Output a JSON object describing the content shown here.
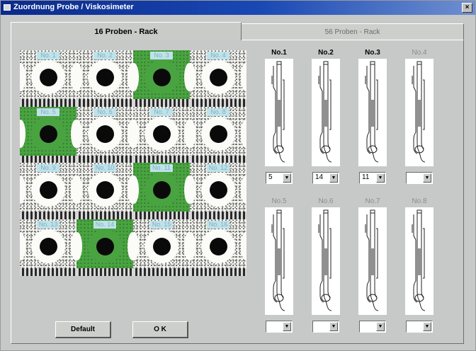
{
  "window": {
    "title": "Zuordnung Probe / Viskosimeter",
    "close_label": "×"
  },
  "tabs": [
    {
      "label": "16 Proben - Rack",
      "active": true
    },
    {
      "label": "56 Proben - Rack",
      "active": false
    }
  ],
  "rack": {
    "cells": [
      {
        "label": "No. 1",
        "selected": false
      },
      {
        "label": "No. 2",
        "selected": false
      },
      {
        "label": "No. 3",
        "selected": true
      },
      {
        "label": "No. 4",
        "selected": false
      },
      {
        "label": "No. 5",
        "selected": true
      },
      {
        "label": "No. 6",
        "selected": false
      },
      {
        "label": "No. 7",
        "selected": false
      },
      {
        "label": "No. 8",
        "selected": false
      },
      {
        "label": "No. 9",
        "selected": false
      },
      {
        "label": "No. 10",
        "selected": false
      },
      {
        "label": "No. 11",
        "selected": true
      },
      {
        "label": "No. 12",
        "selected": false
      },
      {
        "label": "No. 13",
        "selected": false
      },
      {
        "label": "No. 14",
        "selected": true
      },
      {
        "label": "No. 15",
        "selected": false
      },
      {
        "label": "No. 16",
        "selected": false
      }
    ]
  },
  "viscometers": [
    {
      "label": "No.1",
      "value": "5",
      "enabled": true
    },
    {
      "label": "No.2",
      "value": "14",
      "enabled": true
    },
    {
      "label": "No.3",
      "value": "11",
      "enabled": true
    },
    {
      "label": "No.4",
      "value": "",
      "enabled": false
    },
    {
      "label": "No.5",
      "value": "",
      "enabled": false
    },
    {
      "label": "No.6",
      "value": "",
      "enabled": false
    },
    {
      "label": "No.7",
      "value": "",
      "enabled": false
    },
    {
      "label": "No.8",
      "value": "",
      "enabled": false
    }
  ],
  "select_arrow": "▼",
  "buttons": {
    "default_label": "Default",
    "ok_label": "O K"
  },
  "colors": {
    "selected_cell": "#4aa341",
    "label_bg": "#bfe2ea",
    "title_bar": "#0a2a8c"
  }
}
